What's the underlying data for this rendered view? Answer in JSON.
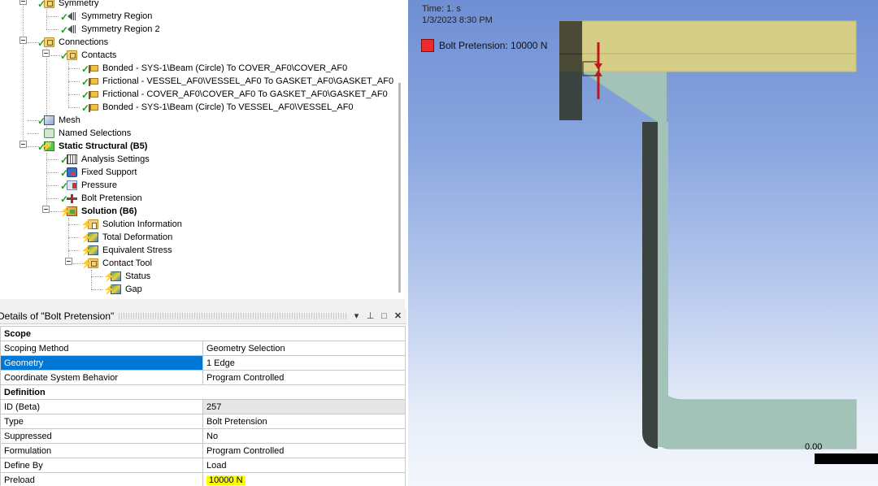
{
  "tree": {
    "items": [
      {
        "label": "Symmetry",
        "icon": "folder-icon",
        "status": "check"
      },
      {
        "label": "Symmetry Region",
        "icon": "symmetry-region-icon",
        "status": "check"
      },
      {
        "label": "Symmetry Region 2",
        "icon": "symmetry-region-icon",
        "status": "check"
      },
      {
        "label": "Connections",
        "icon": "folder-icon",
        "status": "check"
      },
      {
        "label": "Contacts",
        "icon": "folder-icon",
        "status": "check"
      },
      {
        "label": "Bonded - SYS-1\\Beam (Circle) To COVER_AF0\\COVER_AF0",
        "icon": "contact-icon",
        "status": "check"
      },
      {
        "label": "Frictional - VESSEL_AF0\\VESSEL_AF0 To GASKET_AF0\\GASKET_AF0",
        "icon": "contact-icon",
        "status": "check"
      },
      {
        "label": "Frictional - COVER_AF0\\COVER_AF0 To GASKET_AF0\\GASKET_AF0",
        "icon": "contact-icon",
        "status": "check"
      },
      {
        "label": "Bonded - SYS-1\\Beam (Circle) To VESSEL_AF0\\VESSEL_AF0",
        "icon": "contact-icon",
        "status": "check"
      },
      {
        "label": "Mesh",
        "icon": "mesh-icon",
        "status": "check"
      },
      {
        "label": "Named Selections",
        "icon": "named-selections-icon",
        "status": "none"
      },
      {
        "label": "Static Structural (B5)",
        "icon": "static-structural-icon",
        "status": "check-bolt"
      },
      {
        "label": "Analysis Settings",
        "icon": "analysis-settings-icon",
        "status": "check"
      },
      {
        "label": "Fixed Support",
        "icon": "fixed-support-icon",
        "status": "check"
      },
      {
        "label": "Pressure",
        "icon": "pressure-icon",
        "status": "check"
      },
      {
        "label": "Bolt Pretension",
        "icon": "bolt-pretension-icon",
        "status": "check"
      },
      {
        "label": "Solution (B6)",
        "icon": "solution-icon",
        "status": "bolt"
      },
      {
        "label": "Solution Information",
        "icon": "solution-information-icon",
        "status": "bolt"
      },
      {
        "label": "Total Deformation",
        "icon": "result-icon",
        "status": "bolt"
      },
      {
        "label": "Equivalent Stress",
        "icon": "result-icon",
        "status": "bolt"
      },
      {
        "label": "Contact Tool",
        "icon": "folder-icon",
        "status": "bolt"
      },
      {
        "label": "Status",
        "icon": "result-icon",
        "status": "bolt"
      },
      {
        "label": "Gap",
        "icon": "result-icon",
        "status": "bolt"
      }
    ]
  },
  "details": {
    "title": "Details of \"Bolt Pretension\"",
    "pin_icon": "pin-icon",
    "dropdown_icon": "dropdown-arrow-icon",
    "maximize_icon": "maximize-icon",
    "close_icon": "close-icon",
    "rows": [
      {
        "kind": "section",
        "label": "Scope"
      },
      {
        "kind": "row",
        "label": "Scoping Method",
        "value": "Geometry Selection"
      },
      {
        "kind": "row",
        "label": "Geometry",
        "value": "1 Edge",
        "selected": true
      },
      {
        "kind": "row",
        "label": "Coordinate System Behavior",
        "value": "Program Controlled"
      },
      {
        "kind": "section",
        "label": "Definition"
      },
      {
        "kind": "row",
        "label": "ID (Beta)",
        "value": "257",
        "shaded": true
      },
      {
        "kind": "row",
        "label": "Type",
        "value": "Bolt Pretension"
      },
      {
        "kind": "row",
        "label": "Suppressed",
        "value": "No"
      },
      {
        "kind": "row",
        "label": "Formulation",
        "value": "Program Controlled"
      },
      {
        "kind": "row",
        "label": "Define By",
        "value": "Load"
      },
      {
        "kind": "row",
        "label": "Preload",
        "value": "10000 N",
        "highlight": true
      }
    ]
  },
  "viewport": {
    "time": "Time: 1. s",
    "date": "1/3/2023 8:30 PM",
    "legend_label": "Bolt Pretension: 10000 N",
    "legend_color": "#ee2a2a",
    "scale_zero": "0.00"
  },
  "colors": {
    "selection": "#0078d7",
    "highlight": "#ffff00",
    "cover": "#d6cd87",
    "vessel": "#a3c3b8",
    "gasket": "#3b4441"
  }
}
